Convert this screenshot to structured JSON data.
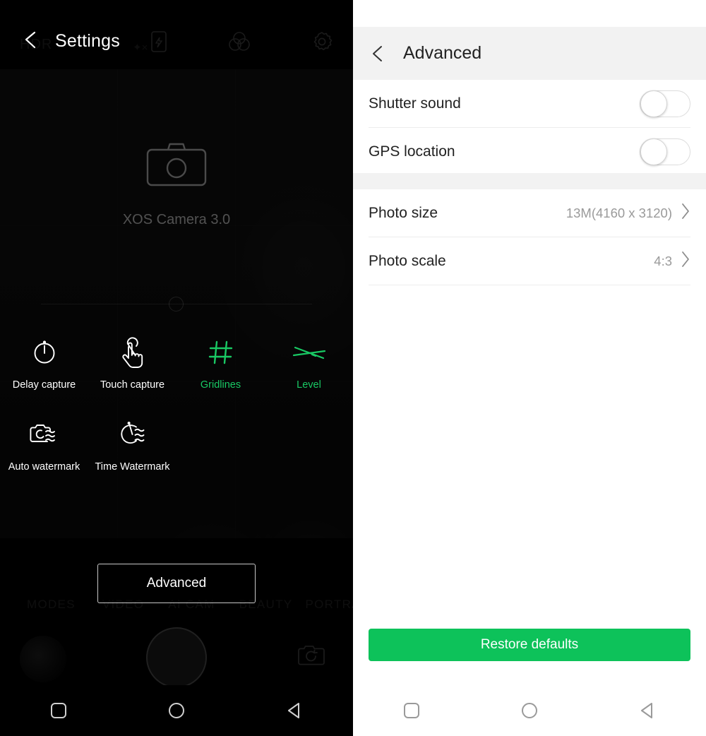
{
  "left_panel": {
    "header": {
      "title": "Settings",
      "back_icon": "chevron-left-icon",
      "ghost_hdr_label": "HDR",
      "ghost_ai_label": "✦×",
      "icons": [
        "phone-flash-icon",
        "color-filter-icon",
        "gear-icon"
      ]
    },
    "brand": {
      "icon": "camera-icon",
      "label": "XOS Camera 3.0"
    },
    "features": [
      {
        "label": "Delay capture",
        "icon": "timer-icon",
        "active": false
      },
      {
        "label": "Touch capture",
        "icon": "touch-hand-icon",
        "active": false
      },
      {
        "label": "Gridlines",
        "icon": "grid-hash-icon",
        "active": true
      },
      {
        "label": "Level",
        "icon": "level-line-icon",
        "active": true
      },
      {
        "label": "Auto watermark",
        "icon": "camera-watermark-icon",
        "active": false
      },
      {
        "label": "Time Watermark",
        "icon": "clock-watermark-icon",
        "active": false
      }
    ],
    "advanced_button": "Advanced",
    "mode_strip": [
      "MODES",
      "VIDEO",
      "AI CAM",
      "BEAUTY",
      "PORTRAIT"
    ],
    "capture": {
      "thumbnail": "gallery-thumbnail",
      "shutter": "shutter-button",
      "switch_camera_icon": "switch-camera-icon"
    },
    "navbar": [
      "recents-square-icon",
      "home-circle-icon",
      "back-triangle-icon"
    ]
  },
  "right_panel": {
    "header": {
      "title": "Advanced",
      "back_icon": "chevron-left-icon"
    },
    "group_toggles": [
      {
        "label": "Shutter sound",
        "state": "off"
      },
      {
        "label": "GPS location",
        "state": "off"
      }
    ],
    "group_values": [
      {
        "label": "Photo size",
        "value": "13M(4160 x 3120)",
        "chevron": "chevron-right-icon"
      },
      {
        "label": "Photo scale",
        "value": "4:3",
        "chevron": "chevron-right-icon"
      }
    ],
    "restore_button": "Restore defaults",
    "navbar": [
      "recents-square-icon",
      "home-circle-icon",
      "back-triangle-icon"
    ]
  },
  "colors": {
    "accent_green": "#0dc25a",
    "active_feature_green": "#19c964",
    "header_gray": "#f2f2f2",
    "value_gray": "#9a9a9a",
    "panel_black": "#000000"
  }
}
